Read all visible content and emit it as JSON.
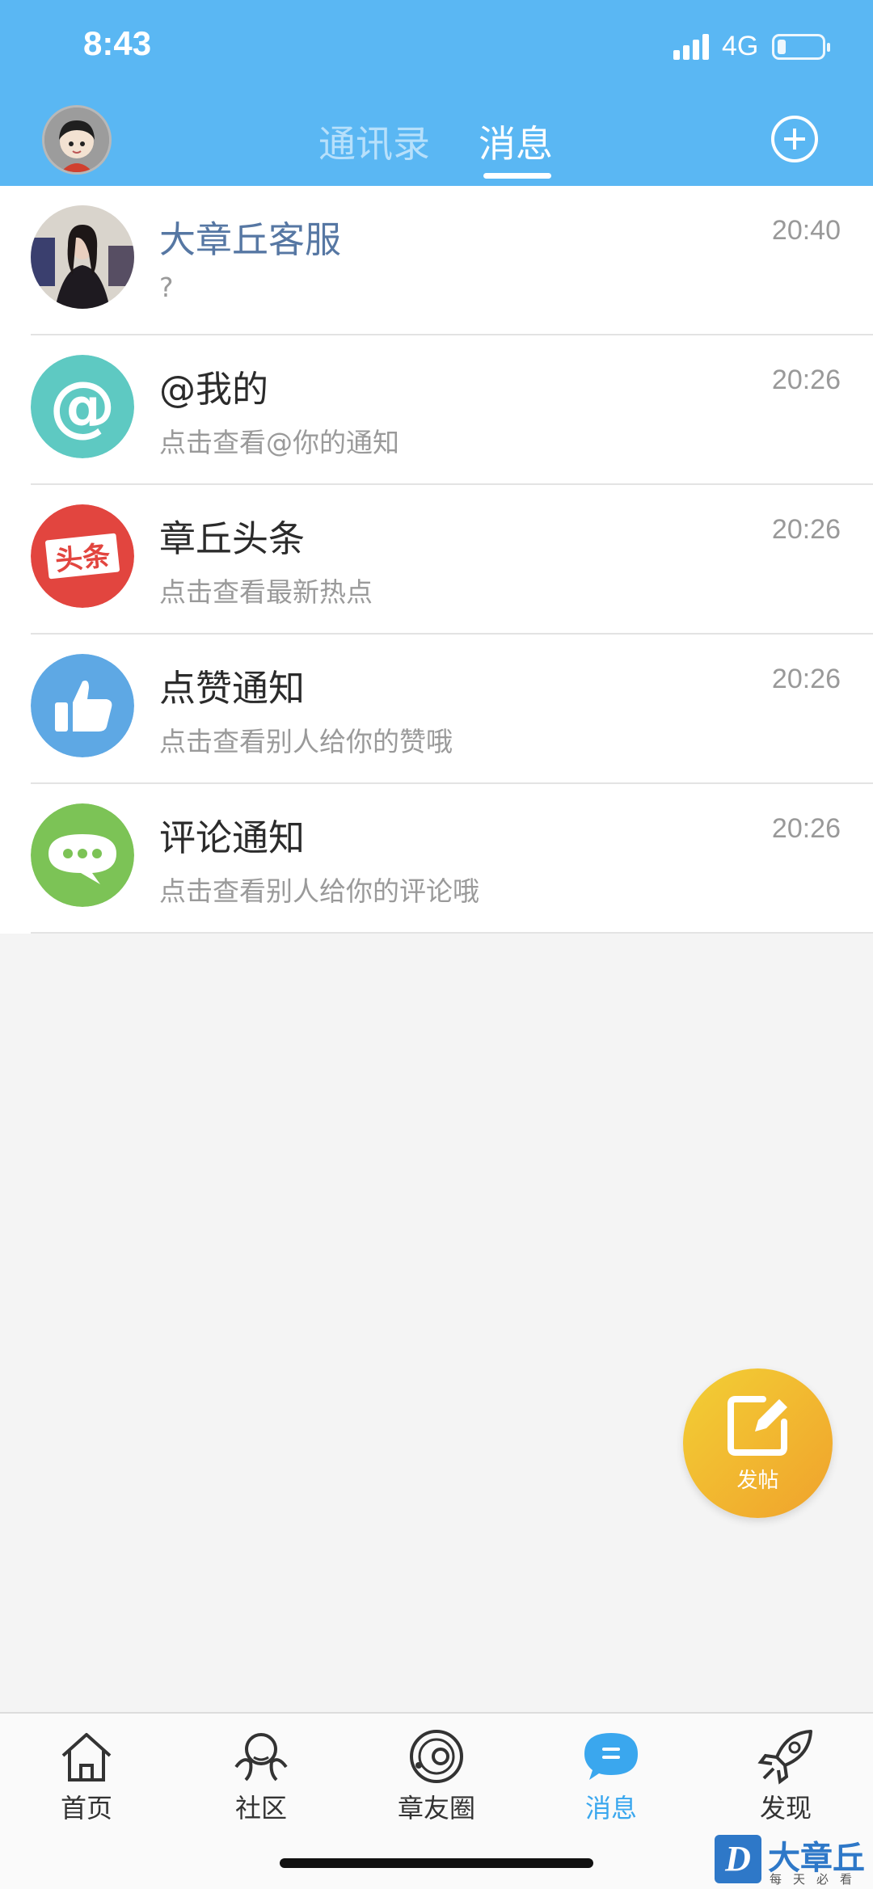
{
  "status_bar": {
    "time": "8:43",
    "network": "4G"
  },
  "header": {
    "tabs": [
      {
        "label": "通讯录"
      },
      {
        "label": "消息"
      }
    ],
    "active_tab": "消息"
  },
  "messages": [
    {
      "title": "大章丘客服",
      "subtitle": "?",
      "time": "20:40",
      "icon": "profile-photo"
    },
    {
      "title": "@我的",
      "subtitle": "点击查看@你的通知",
      "time": "20:26",
      "icon": "at-icon",
      "color": "#5ec9c2"
    },
    {
      "title": "章丘头条",
      "subtitle": "点击查看最新热点",
      "time": "20:26",
      "icon": "headline-icon",
      "badge_text": "头条",
      "color": "#e2453f"
    },
    {
      "title": "点赞通知",
      "subtitle": "点击查看别人给你的赞哦",
      "time": "20:26",
      "icon": "thumbs-up-icon",
      "color": "#5ea8e4"
    },
    {
      "title": "评论通知",
      "subtitle": "点击查看别人给你的评论哦",
      "time": "20:26",
      "icon": "comment-icon",
      "color": "#7cc356"
    }
  ],
  "fab": {
    "label": "发帖",
    "icon": "edit-icon"
  },
  "tabbar": {
    "items": [
      {
        "label": "首页",
        "icon": "home-icon"
      },
      {
        "label": "社区",
        "icon": "community-icon"
      },
      {
        "label": "章友圈",
        "icon": "friends-circle-icon"
      },
      {
        "label": "消息",
        "icon": "message-icon"
      },
      {
        "label": "发现",
        "icon": "rocket-icon"
      }
    ],
    "active": "消息"
  },
  "watermark": {
    "logo_text": "D",
    "name": "大章丘",
    "slogan": "每天必看"
  },
  "colors": {
    "header": "#5ab7f3",
    "accent": "#3aa7ee",
    "fab": "#f0b330"
  }
}
